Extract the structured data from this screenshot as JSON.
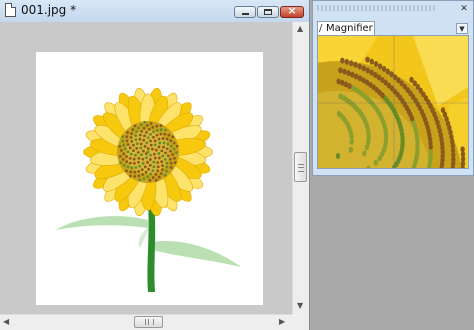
{
  "image_window": {
    "title": "001.jpg *",
    "icon": "document-icon",
    "controls": [
      "minimize-icon",
      "maximize-icon",
      "close-icon"
    ]
  },
  "canvas": {
    "image": "sunflower illustration",
    "background_color": "#c9c9c9"
  },
  "magnifier": {
    "tab_label": "Magnifier",
    "menu_icon": "chevron-down-icon",
    "close_icon": "close-icon"
  },
  "colors": {
    "petal": "#f6c90e",
    "petal_light": "#fde36a",
    "center": "#c9a21b",
    "seed": "#8a5a1c",
    "stem": "#2f8c2a",
    "leaf": "#b9dfb3",
    "close_button": "#c2412a"
  }
}
